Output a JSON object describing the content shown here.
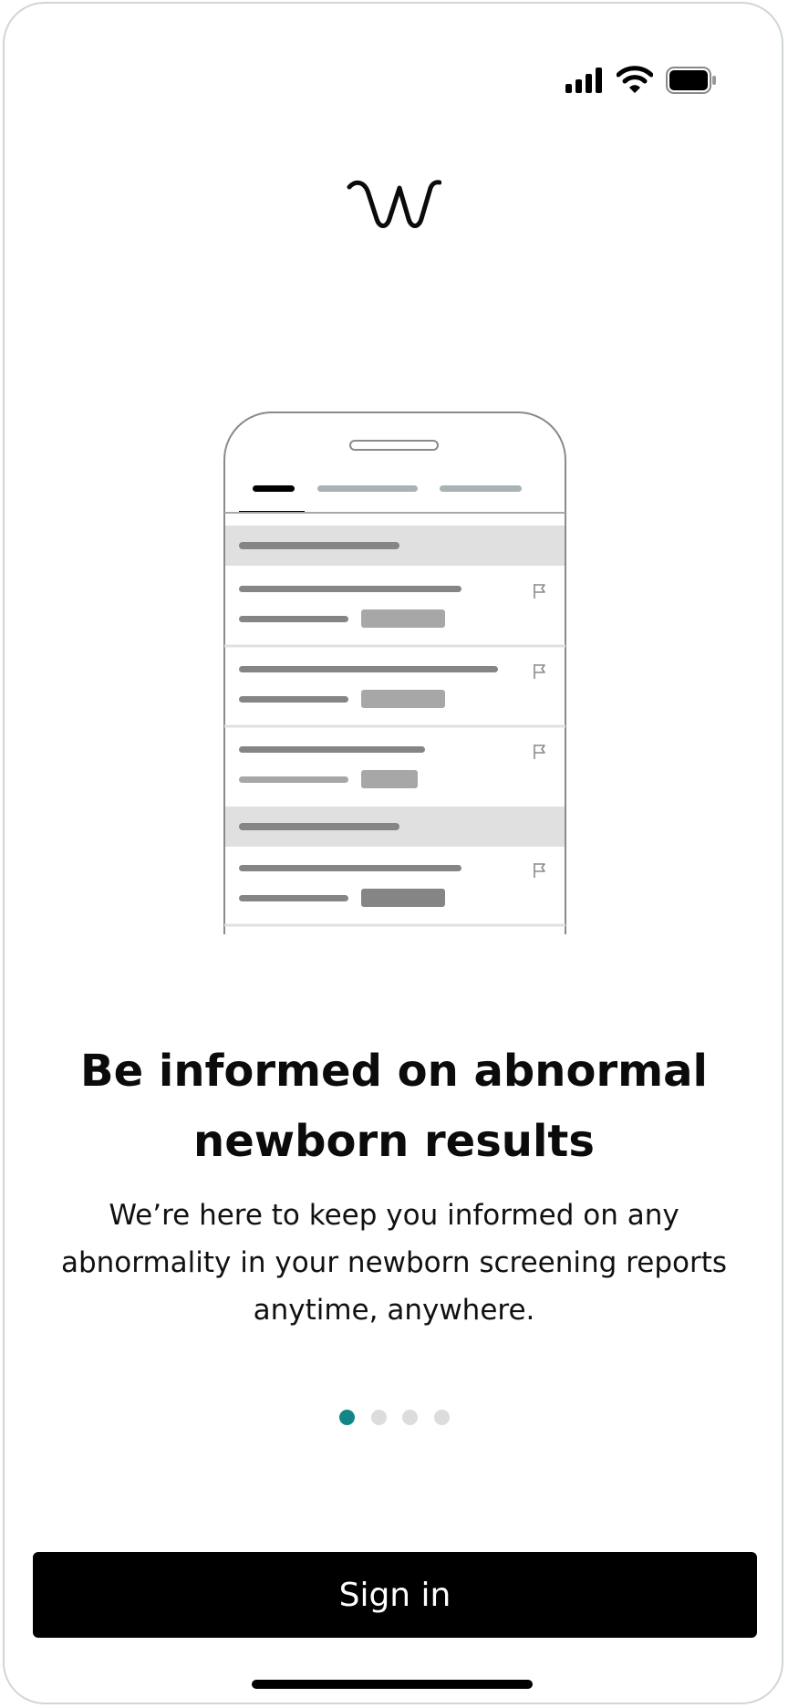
{
  "status_bar": {
    "icons": [
      "cellular-signal-icon",
      "wifi-icon",
      "battery-icon"
    ]
  },
  "logo": {
    "icon": "brand-logo-icon"
  },
  "illustration": {
    "icon": "phone-report-list-illustration",
    "flag_icon": "flag-icon"
  },
  "onboarding": {
    "title": "Be informed on abnormal newborn results",
    "subtitle": "We’re here to keep you informed on any abnormality in your newborn screening reports anytime, anywhere.",
    "page_total": 4,
    "page_current": 1,
    "accent_color": "#138586"
  },
  "actions": {
    "signin_label": "Sign in"
  }
}
